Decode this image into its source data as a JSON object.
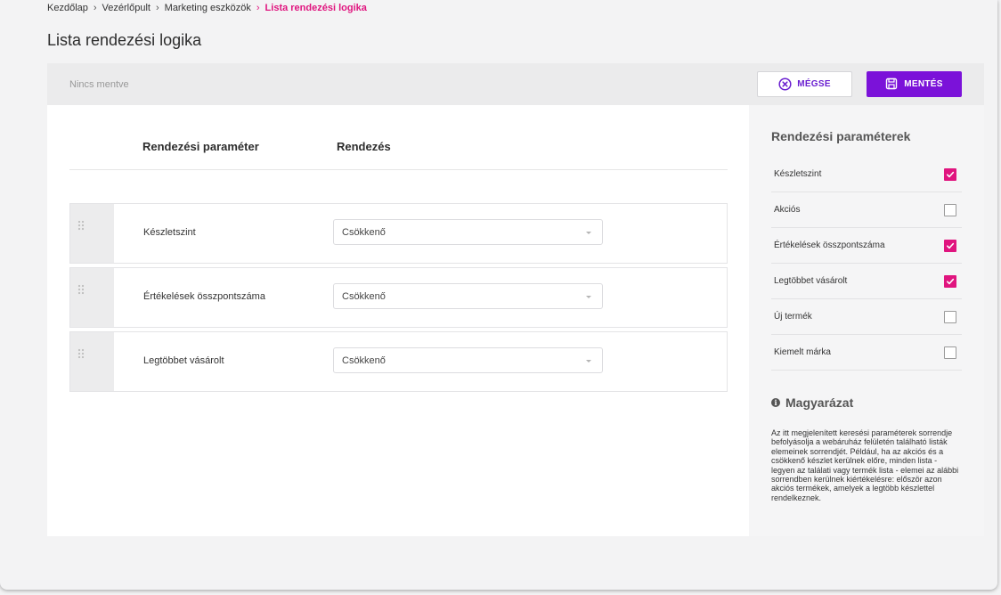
{
  "breadcrumb": {
    "items": [
      "Kezdőlap",
      "Vezérlőpult",
      "Marketing eszközök"
    ],
    "active": "Lista rendezési logika",
    "separator": "›"
  },
  "page": {
    "title": "Lista rendezési logika"
  },
  "toolbar": {
    "status": "Nincs mentve",
    "cancel_label": "MÉGSE",
    "save_label": "MENTÉS"
  },
  "table": {
    "headers": {
      "param": "Rendezési paraméter",
      "order": "Rendezés"
    },
    "rows": [
      {
        "label": "Készletszint",
        "order": "Csökkenő"
      },
      {
        "label": "Értékelések összpontszáma",
        "order": "Csökkenő"
      },
      {
        "label": "Legtöbbet vásárolt",
        "order": "Csökkenő"
      }
    ]
  },
  "side": {
    "title": "Rendezési paraméterek",
    "params": [
      {
        "label": "Készletszint",
        "checked": true
      },
      {
        "label": "Akciós",
        "checked": false
      },
      {
        "label": "Értékelések összpontszáma",
        "checked": true
      },
      {
        "label": "Legtöbbet vásárolt",
        "checked": true
      },
      {
        "label": "Új termék",
        "checked": false
      },
      {
        "label": "Kiemelt márka",
        "checked": false
      }
    ],
    "explanation_title": "Magyarázat",
    "explanation_text": "Az itt megjelenített keresési paraméterek sorrendje befolyásolja a webáruház felületén található listák elemeinek sorrendjét. Például, ha az akciós és a csökkenő készlet kerülnek előre, minden lista - legyen az találati vagy termék lista - elemei az alábbi sorrendben kerülnek kiértékelésre: először azon akciós termékek, amelyek a legtöbb készlettel rendelkeznek."
  },
  "colors": {
    "accent": "#e0157f",
    "primary": "#7b12d9"
  },
  "icons": {
    "cancel": "close-circle-icon",
    "save": "floppy-disk-icon",
    "drag": "drag-handle-icon",
    "info": "info-icon"
  }
}
